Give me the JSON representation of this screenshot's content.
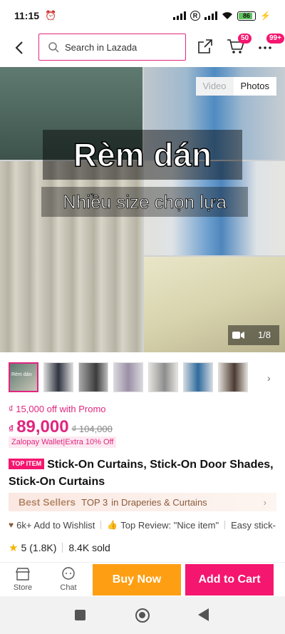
{
  "status_bar": {
    "time": "11:15",
    "battery": "86"
  },
  "header": {
    "search_placeholder": "Search in Lazada",
    "cart_badge": "50",
    "more_badge": "99+"
  },
  "gallery": {
    "tabs": [
      "Video",
      "Photos"
    ],
    "active_tab": "Photos",
    "overlay_title": "Rèm dán",
    "overlay_subtitle": "Nhiều size chọn lựa",
    "counter": "1/8"
  },
  "thumbnails": {
    "count": 8,
    "thumb_text": [
      "Rèm dán",
      "",
      "",
      "",
      "",
      "",
      "",
      ""
    ]
  },
  "pricing": {
    "promo": "₫ 15,000 off with Promo",
    "currency": "₫",
    "price": "89,000",
    "original_price": "₫ 104,000",
    "wallet_tag": "Zalopay Wallet|Extra 10% Off"
  },
  "product": {
    "badge": "TOP ITEM",
    "title": "Stick-On Curtains, Stick-On Door Shades, Stick-On Curtains"
  },
  "best_sellers": {
    "label": "Best Sellers",
    "rank": "TOP 3",
    "category": "in Draperies & Curtains"
  },
  "info": {
    "wishlist": "6k+ Add to Wishlist",
    "top_review": "Top Review: \"Nice item\"",
    "extra": "Easy stick-"
  },
  "stats": {
    "rating": "5",
    "rating_count": "(1.8K)",
    "sold": "8.4K sold"
  },
  "bottom_bar": {
    "store_label": "Store",
    "chat_label": "Chat",
    "buy_now": "Buy Now",
    "add_to_cart": "Add to Cart"
  },
  "colors": {
    "accent": "#f5166f",
    "buy_now": "#fe9f13",
    "price": "#e0267f"
  }
}
